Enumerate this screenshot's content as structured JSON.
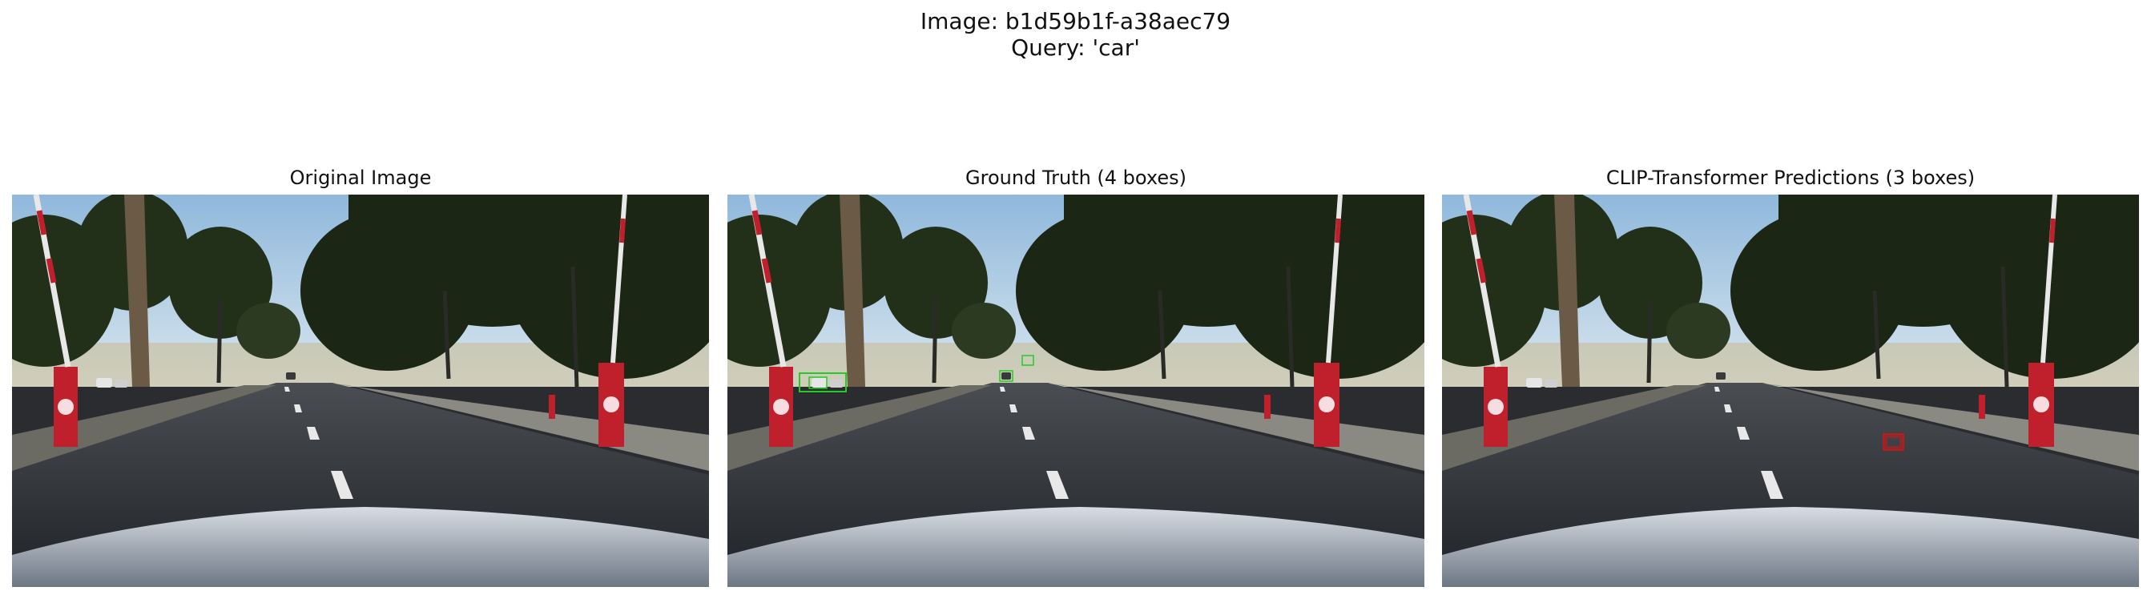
{
  "figure": {
    "title_line1": "Image: b1d59b1f-a38aec79",
    "title_line2": "Query: 'car'"
  },
  "panels": [
    {
      "title": "Original Image"
    },
    {
      "title": "Ground Truth (4 boxes)"
    },
    {
      "title": "CLIP-Transformer Predictions (3 boxes)"
    }
  ],
  "colors": {
    "ground_truth_box": "#22cc22",
    "prediction_box": "#e01010",
    "sky": "#bcd7ea",
    "road": "#2f3237",
    "foliage": "#1f2a17",
    "bollard": "#c0202c"
  }
}
